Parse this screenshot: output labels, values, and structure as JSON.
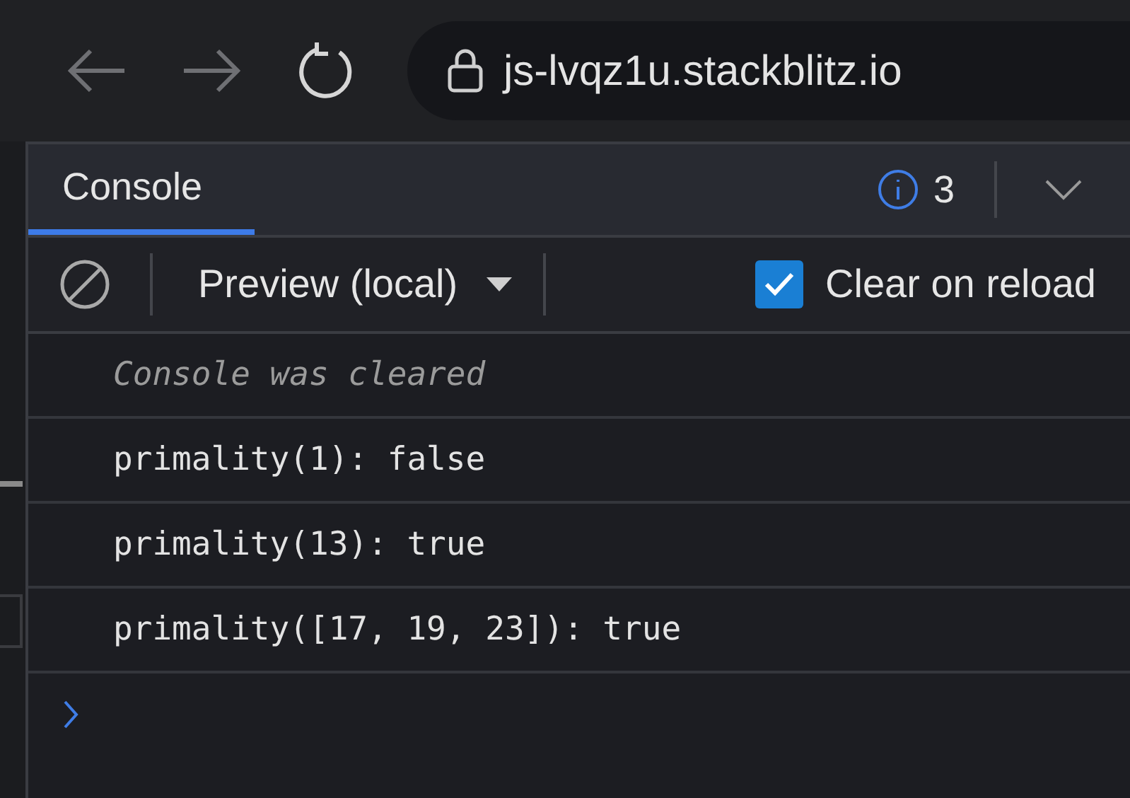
{
  "browser": {
    "url": "js-lvqz1u.stackblitz.io"
  },
  "tabs": [
    {
      "label": "Console",
      "selected": true
    }
  ],
  "issues": {
    "count": "3"
  },
  "toolbar": {
    "context": "Preview (local)",
    "clear_on_reload": {
      "label": "Clear on reload",
      "checked": true
    }
  },
  "messages": [
    {
      "kind": "info",
      "text": "Console was cleared"
    },
    {
      "kind": "log",
      "text": "primality(1): false"
    },
    {
      "kind": "log",
      "text": "primality(13): true"
    },
    {
      "kind": "log",
      "text": "primality([17, 19, 23]): true"
    }
  ]
}
